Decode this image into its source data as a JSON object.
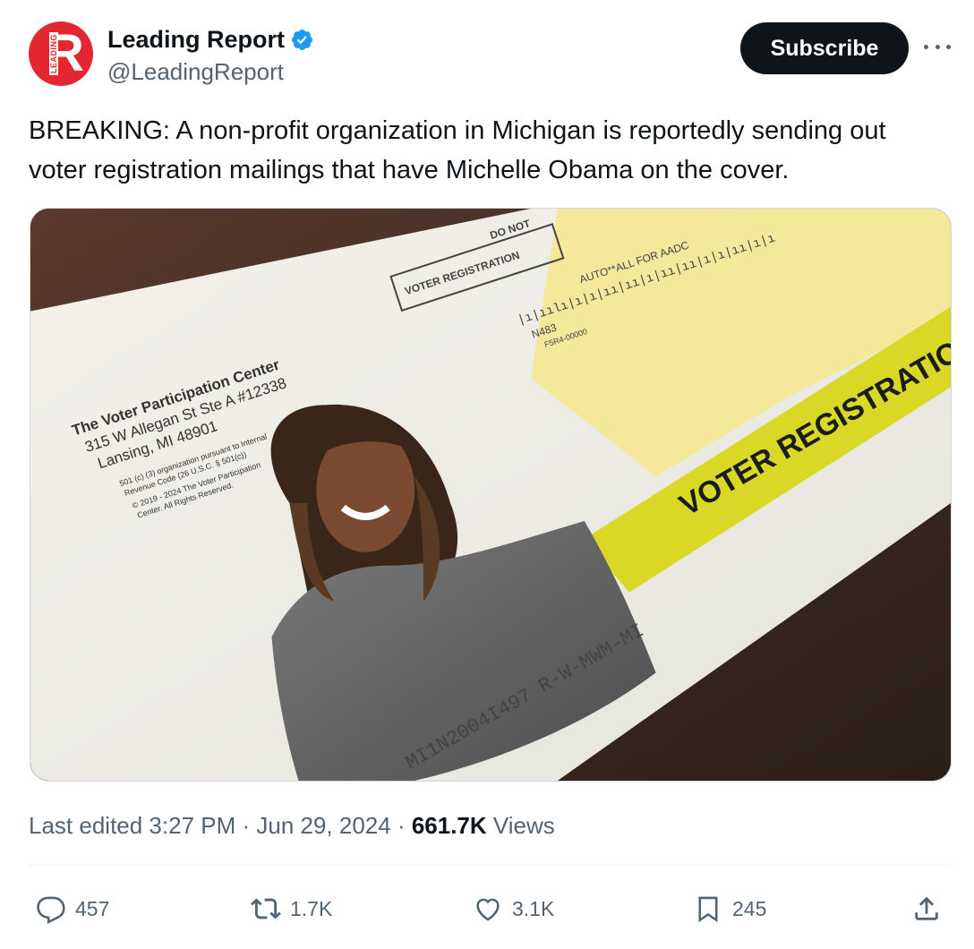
{
  "account": {
    "display_name": "Leading Report",
    "handle": "@LeadingReport",
    "avatar_letter": "R",
    "avatar_side_text": "LEADING",
    "brand_color": "#e3262f",
    "verified_color": "#1d9bf0"
  },
  "header": {
    "subscribe_label": "Subscribe"
  },
  "tweet": {
    "text": "BREAKING: A non-profit organization in Michigan is reportedly sending out voter registration mailings that have Michelle Obama on the cover."
  },
  "media": {
    "sender_name": "The Voter Participation Center",
    "sender_address_1": "315 W Allegan St Ste A #12338",
    "sender_address_2": "Lansing, MI 48901",
    "fine_print_1": "501 (c) (3) organization pursuant to Internal",
    "fine_print_2": "Revenue Code (26 U.S.C. § 501(c))",
    "fine_print_3": "© 2019 - 2024 The Voter Participation",
    "fine_print_4": "Center. All Rights Reserved.",
    "window_box": "VOTER REGISTRATION",
    "window_box_2": "DO NOT",
    "barcode_code": "N483",
    "barcode_code_2": "F5R4-00000",
    "auto_line": "AUTO**ALL FOR AADC",
    "band_text": "VOTER REGISTRATIO",
    "mail_id": "MI1N2004I497  R-W-MWM-MI"
  },
  "meta": {
    "edited": "Last edited 3:27 PM · Jun 29, 2024 · ",
    "views_count": "661.7K",
    "views_label": " Views"
  },
  "actions": {
    "replies": "457",
    "reposts": "1.7K",
    "likes": "3.1K",
    "bookmarks": "245"
  },
  "icons": [
    "verified-badge-icon",
    "more-icon",
    "reply-icon",
    "repost-icon",
    "like-icon",
    "bookmark-icon",
    "share-icon"
  ]
}
